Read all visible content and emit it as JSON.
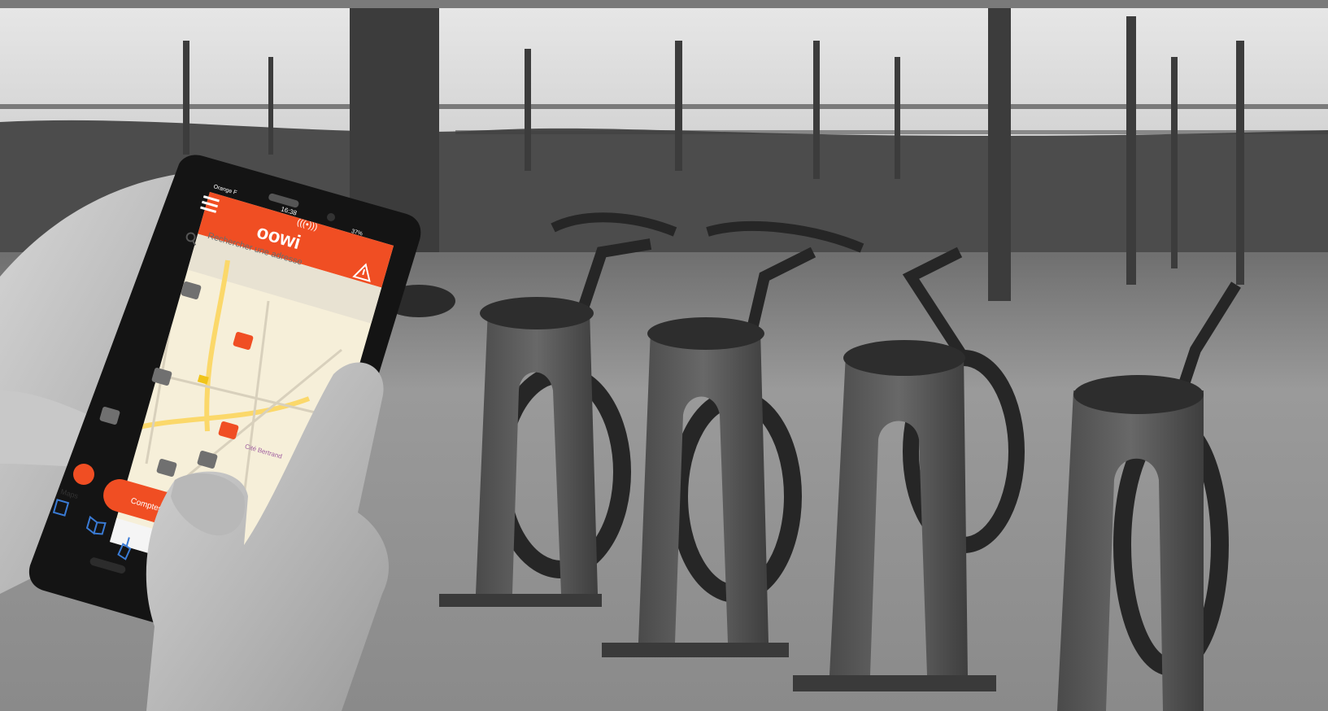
{
  "photo": {
    "subject": "hands holding smartphone in front of bike-sharing docking station",
    "colors": {
      "background_frame": "#7a7a7a",
      "accent_orange": "#f04e23",
      "map_background": "#f6efd9"
    }
  },
  "phone_app": {
    "status_bar": {
      "carrier": "Orange F",
      "time": "16:38",
      "battery": "37%"
    },
    "header": {
      "logo_text": "oowi",
      "logo_badge": "(((•)))",
      "menu_icon": "hamburger-menu-icon",
      "alert_icon": "warning-triangle-icon"
    },
    "search": {
      "icon": "search-icon",
      "placeholder": "Rechercher une adresse"
    },
    "map": {
      "station_markers_gray": 7,
      "station_markers_orange": 2,
      "place_label": "Cité Bertrand"
    },
    "bottom_actions": {
      "cta_label": "Comptes w",
      "back_label": "Maps"
    }
  }
}
